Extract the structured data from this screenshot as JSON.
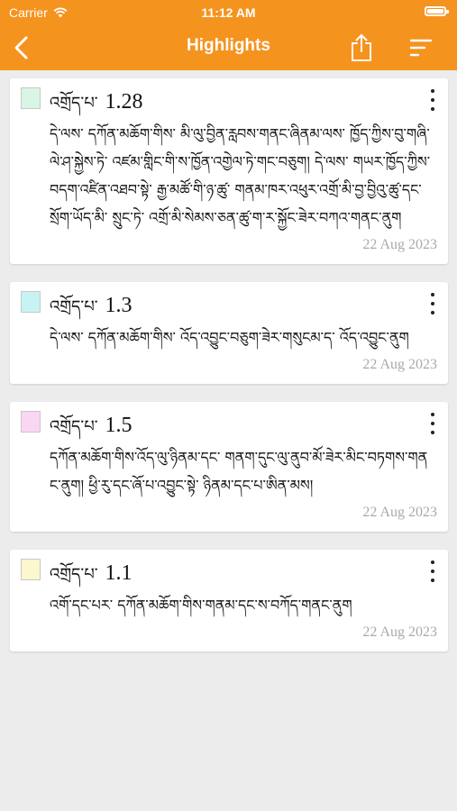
{
  "status_bar": {
    "carrier": "Carrier",
    "time": "11:12 AM"
  },
  "nav": {
    "title": "Highlights"
  },
  "highlights": [
    {
      "color": "#d9f5e6",
      "label": "འགྲོད་པ་",
      "number": "1.28",
      "text": "དེ་ལས་ དཀོན་མཆོག་གིས་ མི་ལུ་བྱིན་རླབས་གནང་ཞིནམ་ལས་ ཁྱོད་ཀྱིས་བུ་གཞི་ལེ་ཤ་སྐྱེས་ཏེ་ འཛམ་གླིང་གི་ས་ཁྱོན་འགྱེལ་ཏེ་གང་བཅུག། དེ་ལས་ གཡར་ཁྱོད་ཀྱིས་བདག་འཛིན་འཐབ་སྟེ་ རྒྱ་མཚོ་གི་ཉ་ཚུ་ གནམ་ཁར་འཕུར་འགྲོ་མི་བྱ་བྱིའུ་ཚུ་དང་ སྲོག་ཡོད་མི་ སྲུང་ཏེ་ འགྲོ་མི་སེམས་ཅན་ཚུ་ག་ར་སྐྱོང་ཟེར་བཀའ་གནང་ནུག",
      "date": "22 Aug 2023"
    },
    {
      "color": "#c7f3f4",
      "label": "འགྲོད་པ་",
      "number": "1.3",
      "text": "དེ་ལས་ དཀོན་མཆོག་གིས་ འོད་འབྱུང་བཅུག་ཟེར་གསུངམ་ད་ འོད་འབྱུང་ནུག",
      "date": "22 Aug 2023"
    },
    {
      "color": "#f9d6f2",
      "label": "འགྲོད་པ་",
      "number": "1.5",
      "text": "དཀོན་མཆོག་གིས་འོད་ལུ་ཉིནམ་དང་ གནག་དུང་ལུ་ནུབ་མོ་ཟེར་མིང་བཏགས་གནང་ནུག། ཕྱི་རུ་དང་ཞོ་པ་འབྱུང་སྟེ་ ཉིནམ་དང་པ་ཨིན་མས།",
      "date": "22 Aug 2023"
    },
    {
      "color": "#fbf7cf",
      "label": "འགྲོད་པ་",
      "number": "1.1",
      "text": "འགོ་དང་པར་ དཀོན་མཆོག་གིས་གནམ་དང་ས་བཀོད་གནང་ནུག",
      "date": "22 Aug 2023"
    }
  ]
}
